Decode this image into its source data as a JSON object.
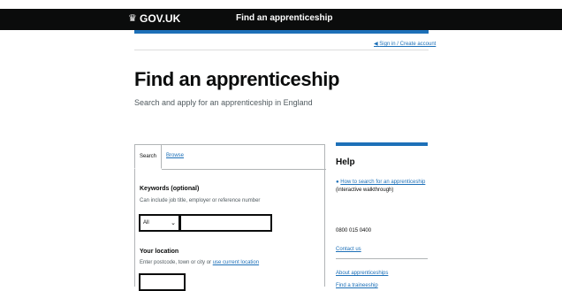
{
  "header": {
    "crown_icon": "crown-icon",
    "logo_text": "GOV.UK",
    "service_name": "Find an apprenticeship",
    "brand_color": "#1d70b8"
  },
  "account": {
    "signin_text": "Sign in / Create account",
    "icon": "arrow-left-icon"
  },
  "page": {
    "title": "Find an apprenticeship",
    "subtitle": "Search and apply for an apprenticeship in England"
  },
  "tabs": {
    "search_label": "Search",
    "browse_label": "Browse"
  },
  "keywords": {
    "label": "Keywords (optional)",
    "hint": "Can include job title, employer or reference number",
    "select_value": "All",
    "input_value": ""
  },
  "location": {
    "label": "Your location",
    "hint_prefix": "Enter postcode, town or city or ",
    "hint_link": "use current location",
    "input_value": ""
  },
  "help": {
    "title": "Help",
    "link1_icon": "info-icon",
    "link1_text": "How to search for an apprenticeship",
    "link1_suffix": " (interactive walkthrough)",
    "phone": "0800 015 0400",
    "contact": "Contact us",
    "about": "About apprenticeships",
    "more": "Find a traineeship"
  }
}
